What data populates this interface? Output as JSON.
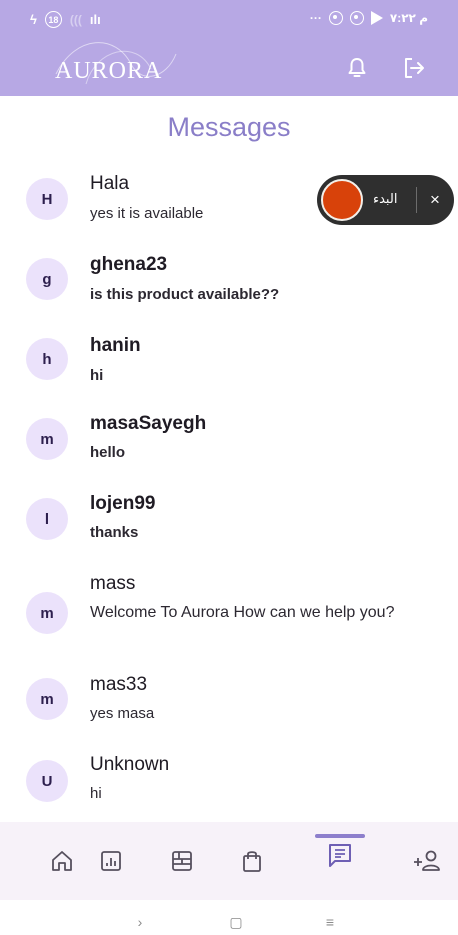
{
  "status_bar": {
    "left_glyph": "ϟ",
    "notification_count": "18",
    "faded_glyph": "(((",
    "signal_glyph": "ılı",
    "right_dots": "···",
    "time": "م ٧:٢٢"
  },
  "header": {
    "logo_text": "AURORA",
    "bell_icon": "bell-icon",
    "logout_icon": "logout-icon",
    "background_color": "#b7a8e4"
  },
  "page": {
    "title": "Messages"
  },
  "conversations": [
    {
      "initial": "H",
      "name": "Hala",
      "message": "yes it is available",
      "unread": false
    },
    {
      "initial": "g",
      "name": "ghena23",
      "message": "is this product available??",
      "unread": true
    },
    {
      "initial": "h",
      "name": "hanin",
      "message": "hi",
      "unread": true
    },
    {
      "initial": "m",
      "name": "masaSayegh",
      "message": "hello",
      "unread": true
    },
    {
      "initial": "l",
      "name": "lojen99",
      "message": "thanks",
      "unread": true
    },
    {
      "initial": "m",
      "name": "mass",
      "message": "Welcome To Aurora How can we help you?",
      "unread": false
    },
    {
      "initial": "m",
      "name": "mas33",
      "message": "yes masa",
      "unread": false
    },
    {
      "initial": "U",
      "name": "Unknown",
      "message": "hi",
      "unread": false
    }
  ],
  "overlay": {
    "label": "البدء",
    "close_label": "×",
    "knob_color": "#d8420a"
  },
  "bottom_nav": {
    "items": [
      {
        "icon": "home-icon"
      },
      {
        "icon": "chart-icon"
      },
      {
        "icon": "dashboard-icon"
      },
      {
        "icon": "shopping-bag-icon"
      },
      {
        "icon": "messages-icon",
        "active": true
      },
      {
        "icon": "add-user-icon"
      }
    ],
    "accent_color": "#8d7fcc"
  },
  "system_nav": {
    "back_glyph": "›",
    "home_glyph": "▢",
    "recents_glyph": "≡"
  }
}
